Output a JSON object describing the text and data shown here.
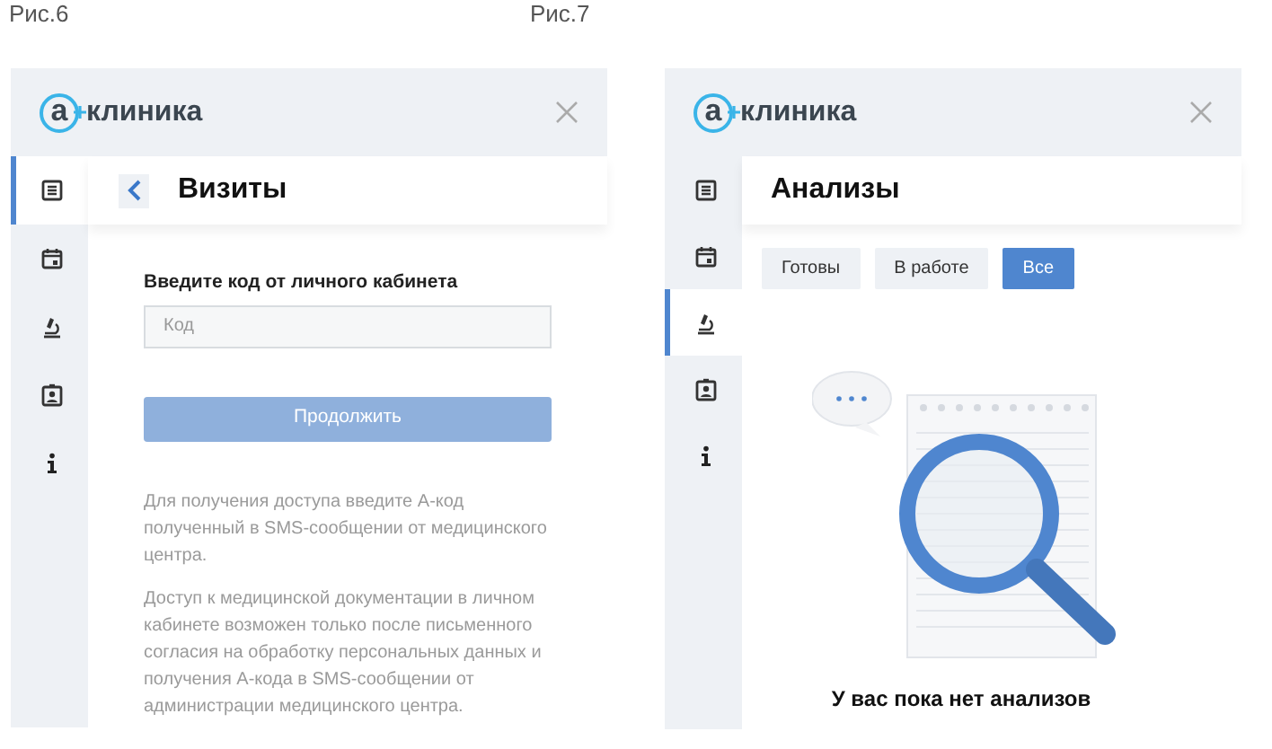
{
  "figures": [
    {
      "caption": "Рис.6",
      "screen": {
        "kind": "login",
        "logo": {
          "mark": "а",
          "name": "клиника"
        },
        "sidebar": [
          {
            "selected": true
          },
          {
            "selected": false
          },
          {
            "selected": false
          },
          {
            "selected": false
          },
          {
            "selected": false
          }
        ],
        "title": "Визиты",
        "field_label": "Введите код от личного кабинета",
        "placeholder": "Код",
        "button": {
          "label": "Продолжить",
          "disabled": true
        },
        "paragraphs": [
          "Для получения доступа введите А-код полученный в SMS-сообщении от медицинского центра.",
          "Доступ к медицинской документации в личном кабинете возможен только после письменного согласия на обработку персональных данных и получения А-кода в SMS-сообщении от администрации медицинского центра."
        ]
      }
    },
    {
      "caption": "Рис.7",
      "screen": {
        "kind": "results",
        "logo": {
          "mark": "а",
          "name": "клиника"
        },
        "sidebar": [
          {
            "selected": false
          },
          {
            "selected": false
          },
          {
            "selected": true
          },
          {
            "selected": false
          },
          {
            "selected": false
          }
        ],
        "title": "Анализы",
        "filters": [
          {
            "label": "Готовы",
            "selected": false
          },
          {
            "label": "В работе",
            "selected": false
          },
          {
            "label": "Все",
            "selected": true
          }
        ],
        "empty_text": "У вас пока нет анализов"
      }
    }
  ]
}
